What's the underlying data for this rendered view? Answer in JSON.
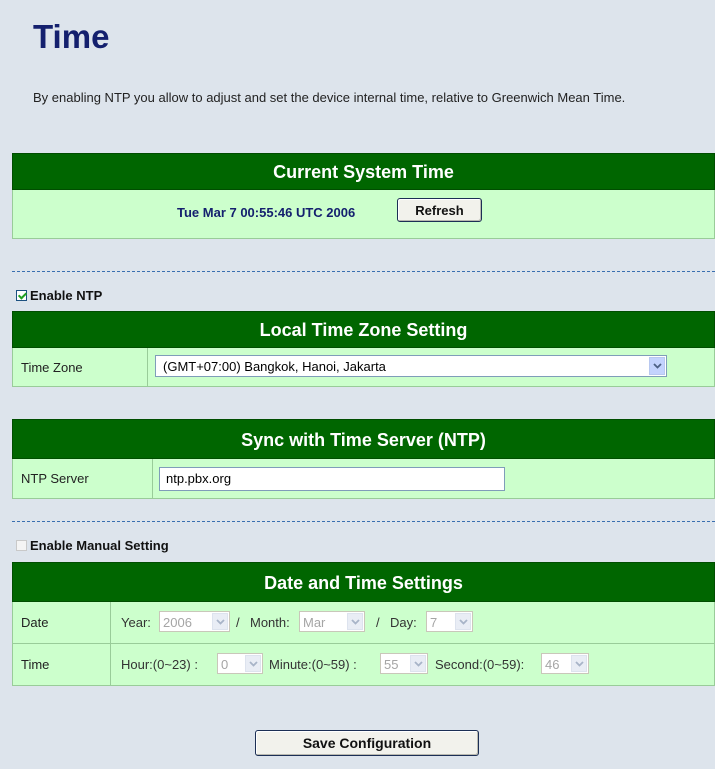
{
  "page": {
    "title": "Time",
    "intro": "By enabling NTP you allow to adjust and set the device internal time, relative to Greenwich Mean Time."
  },
  "current_time": {
    "header": "Current System Time",
    "value": "Tue Mar 7 00:55:46 UTC 2006",
    "refresh_label": "Refresh"
  },
  "ntp": {
    "enable_label": "Enable NTP",
    "enabled": true
  },
  "timezone": {
    "header": "Local Time Zone Setting",
    "label": "Time Zone",
    "selected": "(GMT+07:00) Bangkok, Hanoi, Jakarta"
  },
  "ntp_server": {
    "header": "Sync with Time Server (NTP)",
    "label": "NTP Server",
    "value": "ntp.pbx.org"
  },
  "manual": {
    "enable_label": "Enable Manual Setting",
    "enabled": false
  },
  "datetime": {
    "header": "Date and Time Settings",
    "date_label": "Date",
    "time_label": "Time",
    "year_label": "Year:",
    "year": "2006",
    "month_label": "Month:",
    "month": "Mar",
    "day_label": "Day:",
    "day": "7",
    "separator": "/",
    "hour_label": "Hour:(0~23) :",
    "hour": "0",
    "minute_label": "Minute:(0~59) :",
    "minute": "55",
    "second_label": "Second:(0~59):",
    "second": "46"
  },
  "save_label": "Save Configuration"
}
